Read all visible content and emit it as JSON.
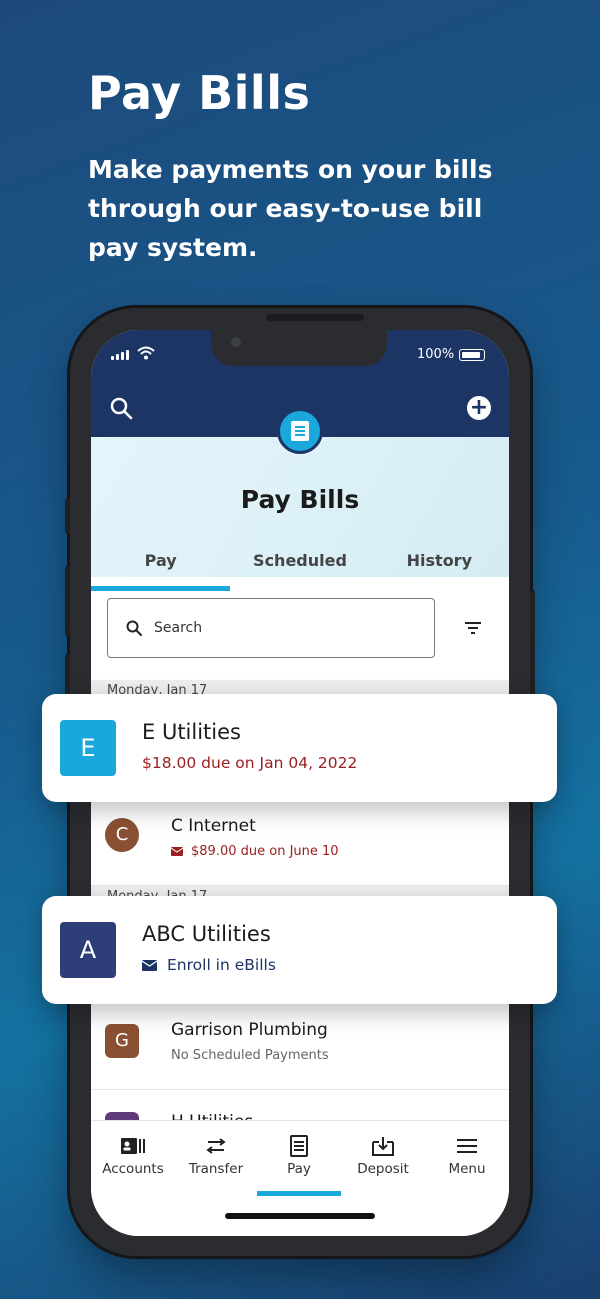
{
  "hero": {
    "title": "Pay Bills",
    "subtitle": "Make payments on your bills through our easy-to-use bill pay system."
  },
  "status_bar": {
    "battery": "100%"
  },
  "app": {
    "page_title": "Pay Bills",
    "tabs": [
      {
        "label": "Pay",
        "active": true
      },
      {
        "label": "Scheduled",
        "active": false
      },
      {
        "label": "History",
        "active": false
      }
    ],
    "search": {
      "placeholder": "Search"
    },
    "date_groups": [
      "Monday, Jan 17",
      "Monday, Jan 17"
    ],
    "bills": [
      {
        "initial": "C",
        "name": "C Internet",
        "sub": "$89.00 due on June 10"
      },
      {
        "initial": "G",
        "name": "Garrison Plumbing",
        "sub": "No Scheduled Payments"
      },
      {
        "initial": "H",
        "name": "H Utilities"
      }
    ],
    "nav": [
      {
        "label": "Accounts",
        "icon": "accounts-icon"
      },
      {
        "label": "Transfer",
        "icon": "transfer-icon"
      },
      {
        "label": "Pay",
        "icon": "pay-icon"
      },
      {
        "label": "Deposit",
        "icon": "deposit-icon"
      },
      {
        "label": "Menu",
        "icon": "menu-icon"
      }
    ]
  },
  "cards": [
    {
      "initial": "E",
      "name": "E Utilities",
      "sub": "$18.00 due on Jan 04, 2022",
      "color": "#1aa7db",
      "sub_color": "#9b2020"
    },
    {
      "initial": "A",
      "name": "ABC Utilities",
      "sub": "Enroll in eBills",
      "color": "#2d3e78",
      "sub_color": "#1c3565"
    }
  ],
  "colors": {
    "accent": "#1aa7db",
    "header": "#1c3565",
    "due": "#9b2020"
  }
}
